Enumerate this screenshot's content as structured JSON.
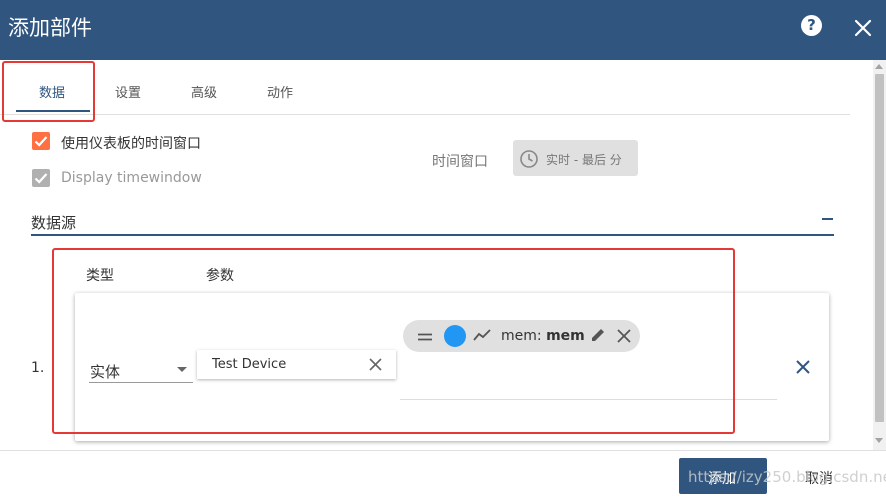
{
  "dialog": {
    "title": "添加部件"
  },
  "tabs": [
    {
      "label": "数据",
      "active": true
    },
    {
      "label": "设置",
      "active": false
    },
    {
      "label": "高级",
      "active": false
    },
    {
      "label": "动作",
      "active": false
    }
  ],
  "checkboxes": {
    "use_dashboard_timewindow": {
      "label": "使用仪表板的时间窗口",
      "checked": true,
      "color": "#ff7043"
    },
    "display_timewindow": {
      "label": "Display timewindow",
      "checked": true,
      "disabled": true
    }
  },
  "timewindow": {
    "label": "时间窗口",
    "button_text": "实时 - 最后 分"
  },
  "datasources": {
    "title": "数据源",
    "columns": {
      "type": "类型",
      "params": "参数"
    },
    "rows": [
      {
        "index": "1.",
        "type": "实体",
        "entity": "Test Device",
        "key": {
          "label": "mem:",
          "name": "mem",
          "color": "#2196f3"
        }
      }
    ]
  },
  "footer": {
    "add_label": "添加",
    "cancel_label": "取消",
    "watermark": "https://izy250.blog.csdn.net"
  },
  "colors": {
    "header": "#305680",
    "accent": "#305680",
    "highlight_box": "#e53935"
  }
}
